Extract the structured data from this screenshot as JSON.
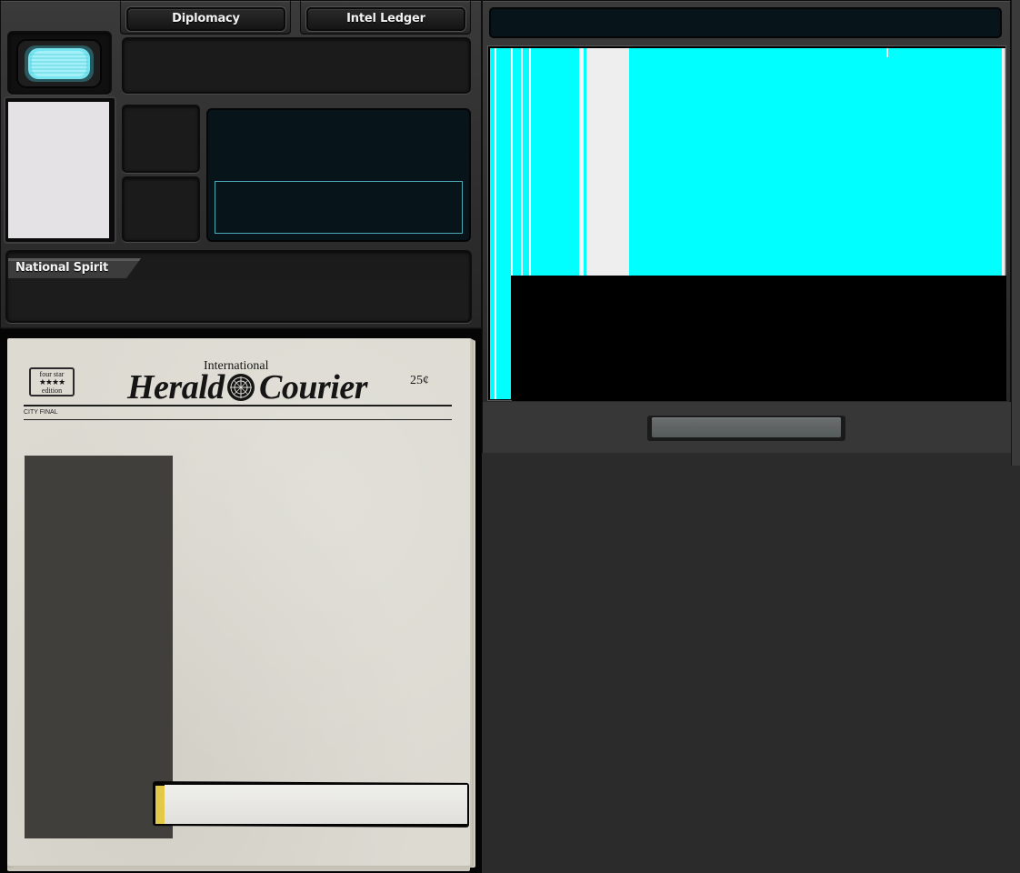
{
  "tabs": {
    "diplomacy": "Diplomacy",
    "intel_ledger": "Intel Ledger"
  },
  "national_spirit": {
    "label": "National Spirit"
  },
  "newspaper": {
    "edition_badge_top": "four star",
    "edition_badge_stars": "★★★★",
    "edition_badge_bottom": "edition",
    "title_small": "International",
    "title_left": "Herald",
    "title_right": "Courier",
    "price": "25¢",
    "edition_line": "CITY FINAL"
  },
  "colors": {
    "frame": "#2b2b2b",
    "screen_accent": "#00ffff",
    "paper": "#dcdad1",
    "photo_placeholder": "#403f3b"
  },
  "icons": {
    "monitor": "crt-monitor-icon",
    "emblem": "globe-emblem-icon"
  }
}
